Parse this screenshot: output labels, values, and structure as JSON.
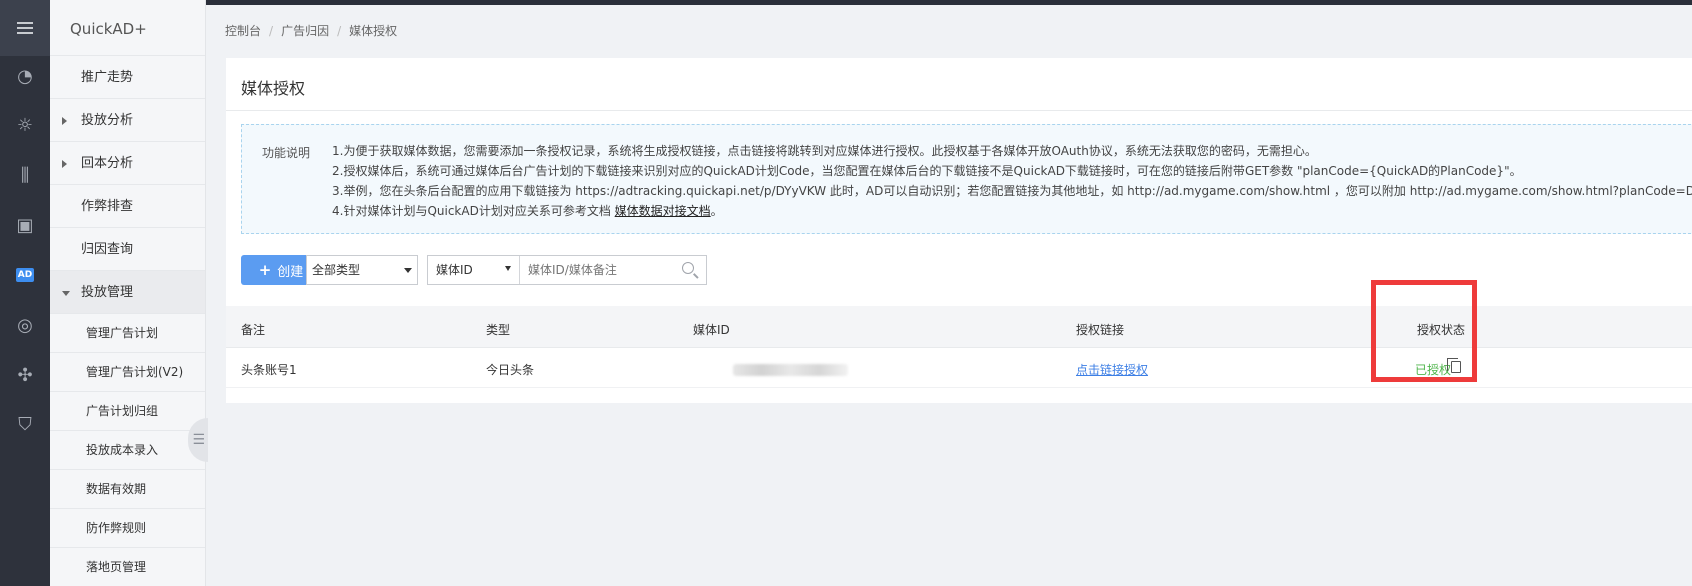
{
  "app": {
    "brand": "QuickAD+"
  },
  "breadcrumb": [
    "控制台",
    "广告归因",
    "媒体授权"
  ],
  "submenu": {
    "items": [
      {
        "label": "推广走势",
        "expand": ""
      },
      {
        "label": "投放分析",
        "expand": "right"
      },
      {
        "label": "回本分析",
        "expand": "right"
      },
      {
        "label": "作弊排查",
        "expand": ""
      },
      {
        "label": "归因查询",
        "expand": ""
      },
      {
        "label": "投放管理",
        "expand": "down"
      }
    ],
    "sub_items": [
      "管理广告计划",
      "管理广告计划(V2)",
      "广告计划归组",
      "投放成本录入",
      "数据有效期",
      "防作弊规则",
      "落地页管理"
    ]
  },
  "iconbar": {
    "icons": [
      "menu-icon",
      "dashboard-icon",
      "sun-icon",
      "bar-chart-icon",
      "dollar-doc-icon",
      "ad-icon",
      "target-icon",
      "network-icon",
      "shield-check-icon"
    ],
    "active": "ad-icon"
  },
  "page": {
    "title": "媒体授权"
  },
  "notice": {
    "label": "功能说明",
    "line1": "1.为便于获取媒体数据，您需要添加一条授权记录，系统将生成授权链接，点击链接将跳转到对应媒体进行授权。此授权基于各媒体开放OAuth协议，系统无法获取您的密码，无需担心。",
    "line2": "2.授权媒体后，系统可通过媒体后台广告计划的下载链接来识别对应的QuickAD计划Code，当您配置在媒体后台的下载链接不是QuickAD下载链接时，可在您的链接后附带GET参数 \"planCode={QuickAD的PlanCode}\"。",
    "line3": "3.举例，您在头条后台配置的应用下载链接为 https://adtracking.quickapi.net/p/DYyVKW 此时，AD可以自动识别；若您配置链接为其他地址，如 http://ad.mygame.com/show.html ，您可以附加 http://ad.mygame.com/show.html?planCode=DYyV",
    "line4_prefix": "4.针对媒体计划与QuickAD计划对应关系可参考文档 ",
    "line4_link": "媒体数据对接文档",
    "line4_suffix": "。"
  },
  "toolbar": {
    "create_label": "创建",
    "type_select": "全部类型",
    "search_type": "媒体ID",
    "search_placeholder": "媒体ID/媒体备注"
  },
  "table": {
    "columns": [
      "备注",
      "类型",
      "媒体ID",
      "授权链接",
      "授权状态"
    ],
    "rows": [
      {
        "remark": "头条账号1",
        "type": "今日头条",
        "media_id": "",
        "link": "点击链接授权",
        "status": "已授权"
      }
    ]
  },
  "colors": {
    "accent": "#5b9cf1",
    "status_ok": "#4fb54b",
    "highlight": "#ee3b3b",
    "link": "#3d7fe5"
  }
}
